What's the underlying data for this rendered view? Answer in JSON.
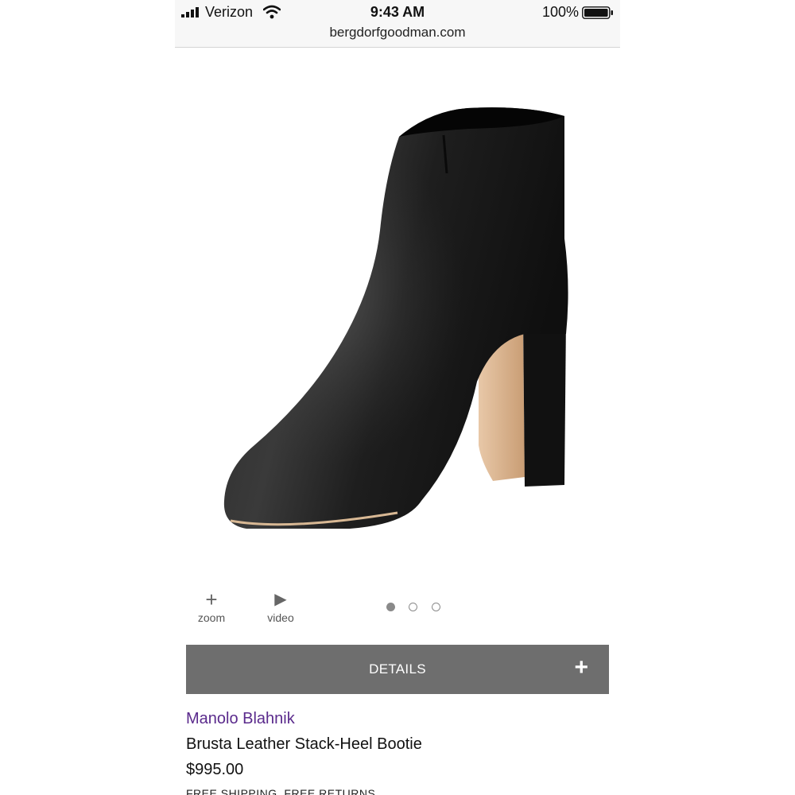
{
  "status_bar": {
    "carrier": "Verizon",
    "time": "9:43 AM",
    "battery_percent": "100%"
  },
  "browser": {
    "url": "bergdorfgoodman.com"
  },
  "media": {
    "zoom_icon": "+",
    "zoom_label": "zoom",
    "video_icon": "▶",
    "video_label": "video",
    "image_count": 3,
    "active_image": 1
  },
  "details": {
    "label": "DETAILS",
    "toggle_icon": "+"
  },
  "product": {
    "brand": "Manolo Blahnik",
    "name": "Brusta Leather Stack-Heel Bootie",
    "price": "$995.00",
    "shipping": "FREE SHIPPING. FREE RETURNS"
  },
  "colors": {
    "brand_text": "#5a2a8c",
    "details_bar": "#6e6e6e"
  }
}
